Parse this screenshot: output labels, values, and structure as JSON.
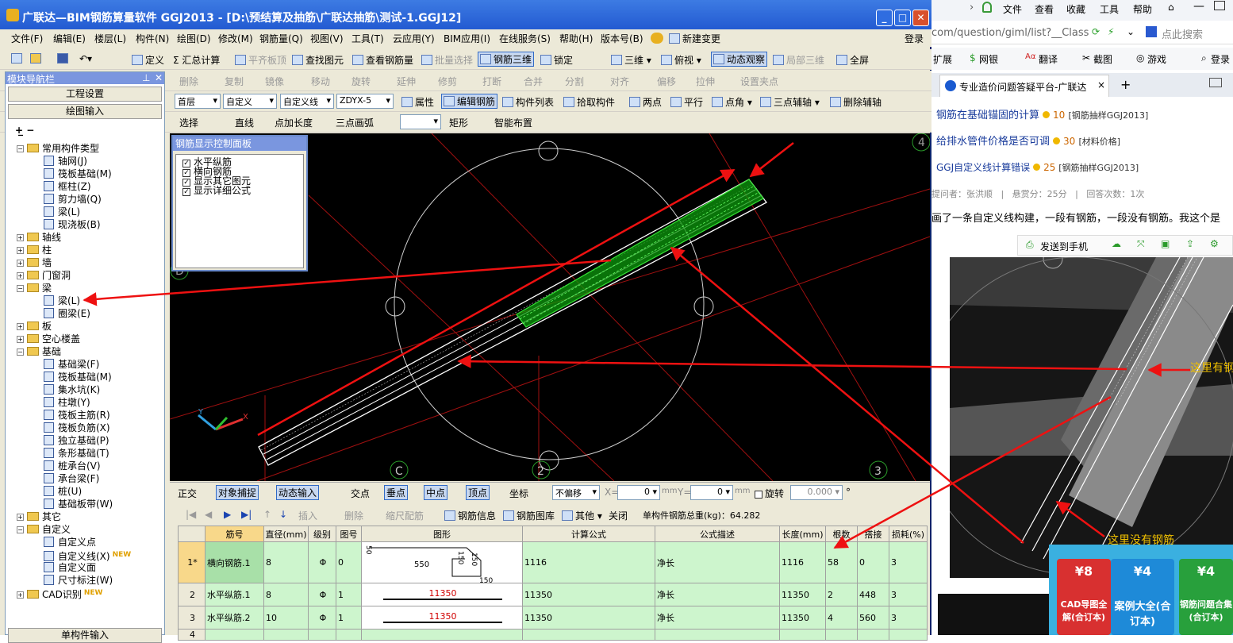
{
  "window": {
    "title": "广联达—BIM钢筋算量软件 GGJ2013 - [D:\\预结算及抽筋\\广联达抽筋\\测试-1.GGJ12]",
    "min": "_",
    "max": "□",
    "close": "✕"
  },
  "menu": [
    "文件(F)",
    "编辑(E)",
    "楼层(L)",
    "构件(N)",
    "绘图(D)",
    "修改(M)",
    "钢筋量(Q)",
    "视图(V)",
    "工具(T)",
    "云应用(Y)",
    "BIM应用(I)",
    "在线服务(S)",
    "帮助(H)",
    "版本号(B)",
    "新建变更",
    "登录"
  ],
  "toolbar1": [
    "定义",
    "Σ 汇总计算",
    "平齐板顶",
    "查找图元",
    "查看钢筋量",
    "批量选择",
    "钢筋三维",
    "锁定",
    "三维",
    "俯视",
    "动态观察",
    "局部三维",
    "全屏"
  ],
  "toolbar2": [
    "删除",
    "复制",
    "镜像",
    "移动",
    "旋转",
    "延伸",
    "修剪",
    "打断",
    "合并",
    "分割",
    "对齐",
    "偏移",
    "拉伸",
    "设置夹点"
  ],
  "toolbar3": {
    "floor": "首层",
    "type": "自定义",
    "subtype": "自定义线",
    "name": "ZDYX-5",
    "items": [
      "属性",
      "编辑钢筋",
      "构件列表",
      "拾取构件",
      "两点",
      "平行",
      "点角",
      "三点辅轴",
      "删除辅轴"
    ]
  },
  "toolbar4": [
    "选择",
    "直线",
    "点加长度",
    "三点画弧",
    "矩形",
    "智能布置"
  ],
  "leftpanel": {
    "title": "模块导航栏",
    "buttons": [
      "工程设置",
      "绘图输入"
    ],
    "tree": [
      {
        "label": "常用构件类型",
        "kind": "folder",
        "open": true,
        "level": 0
      },
      {
        "label": "轴网(J)",
        "kind": "item",
        "level": 1
      },
      {
        "label": "筏板基础(M)",
        "kind": "item",
        "level": 1
      },
      {
        "label": "框柱(Z)",
        "kind": "item",
        "level": 1
      },
      {
        "label": "剪力墙(Q)",
        "kind": "item",
        "level": 1
      },
      {
        "label": "梁(L)",
        "kind": "item",
        "level": 1
      },
      {
        "label": "现浇板(B)",
        "kind": "item",
        "level": 1
      },
      {
        "label": "轴线",
        "kind": "folder",
        "open": false,
        "level": 0
      },
      {
        "label": "柱",
        "kind": "folder",
        "open": false,
        "level": 0
      },
      {
        "label": "墙",
        "kind": "folder",
        "open": false,
        "level": 0
      },
      {
        "label": "门窗洞",
        "kind": "folder",
        "open": false,
        "level": 0
      },
      {
        "label": "梁",
        "kind": "folder",
        "open": true,
        "level": 0
      },
      {
        "label": "梁(L)",
        "kind": "item",
        "level": 1
      },
      {
        "label": "圈梁(E)",
        "kind": "item",
        "level": 1
      },
      {
        "label": "板",
        "kind": "folder",
        "open": false,
        "level": 0
      },
      {
        "label": "空心楼盖",
        "kind": "folder",
        "open": false,
        "level": 0
      },
      {
        "label": "基础",
        "kind": "folder",
        "open": true,
        "level": 0
      },
      {
        "label": "基础梁(F)",
        "kind": "item",
        "level": 1
      },
      {
        "label": "筏板基础(M)",
        "kind": "item",
        "level": 1
      },
      {
        "label": "集水坑(K)",
        "kind": "item",
        "level": 1
      },
      {
        "label": "柱墩(Y)",
        "kind": "item",
        "level": 1
      },
      {
        "label": "筏板主筋(R)",
        "kind": "item",
        "level": 1
      },
      {
        "label": "筏板负筋(X)",
        "kind": "item",
        "level": 1
      },
      {
        "label": "独立基础(P)",
        "kind": "item",
        "level": 1
      },
      {
        "label": "条形基础(T)",
        "kind": "item",
        "level": 1
      },
      {
        "label": "桩承台(V)",
        "kind": "item",
        "level": 1
      },
      {
        "label": "承台梁(F)",
        "kind": "item",
        "level": 1
      },
      {
        "label": "桩(U)",
        "kind": "item",
        "level": 1
      },
      {
        "label": "基础板带(W)",
        "kind": "item",
        "level": 1
      },
      {
        "label": "其它",
        "kind": "folder",
        "open": false,
        "level": 0
      },
      {
        "label": "自定义",
        "kind": "folder",
        "open": true,
        "level": 0
      },
      {
        "label": "自定义点",
        "kind": "item",
        "level": 1
      },
      {
        "label": "自定义线(X)",
        "kind": "item",
        "level": 1,
        "badge": "NEW"
      },
      {
        "label": "自定义面",
        "kind": "item",
        "level": 1
      },
      {
        "label": "尺寸标注(W)",
        "kind": "item",
        "level": 1
      },
      {
        "label": "CAD识别",
        "kind": "folder",
        "open": false,
        "level": 0,
        "badge": "NEW"
      }
    ],
    "footer": "单构件输入"
  },
  "ctrlpanel": {
    "title": "钢筋显示控制面板",
    "options": [
      "水平纵筋",
      "横向钢筋",
      "显示其它图元",
      "显示详细公式"
    ]
  },
  "viewport": {
    "axis_labels": [
      "4",
      "D",
      "C",
      "2",
      "3"
    ],
    "beam_color": "#22c022",
    "arrow_color": "#ee1111"
  },
  "snapbar": {
    "items": [
      "正交",
      "对象捕捉",
      "动态输入",
      "交点",
      "垂点",
      "中点",
      "顶点",
      "坐标"
    ],
    "offset": "不偏移",
    "x_label": "X=",
    "x_val": "0",
    "y_label": "Y=",
    "y_val": "0",
    "unit": "mm",
    "rotate_label": "旋转",
    "rotate_val": "0.000",
    "deg": "°"
  },
  "gridbar": {
    "items": [
      "插入",
      "删除",
      "缩尺配筋",
      "钢筋信息",
      "钢筋图库",
      "其他",
      "关闭"
    ],
    "total": "单构件钢筋总重(kg)：64.282"
  },
  "grid": {
    "headers": [
      "",
      "筋号",
      "直径(mm)",
      "级别",
      "图号",
      "图形",
      "计算公式",
      "公式描述",
      "长度(mm)",
      "根数",
      "搭接",
      "损耗(%)"
    ],
    "rows": [
      {
        "n": "1*",
        "name": "横向钢筋.1",
        "dia": "8",
        "grade": "Φ",
        "fig": "0",
        "shape": {
          "a": "550",
          "b": "150",
          "c": "50",
          "d": "150",
          "e": "65"
        },
        "formula": "1116",
        "desc": "净长",
        "len": "1116",
        "count": "58",
        "lap": "0",
        "loss": "3"
      },
      {
        "n": "2",
        "name": "水平纵筋.1",
        "dia": "8",
        "grade": "Φ",
        "fig": "1",
        "shape": {
          "a": "11350"
        },
        "formula": "11350",
        "desc": "净长",
        "len": "11350",
        "count": "2",
        "lap": "448",
        "loss": "3"
      },
      {
        "n": "3",
        "name": "水平纵筋.2",
        "dia": "10",
        "grade": "Φ",
        "fig": "1",
        "shape": {
          "a": "11350"
        },
        "formula": "11350",
        "desc": "净长",
        "len": "11350",
        "count": "4",
        "lap": "560",
        "loss": "3"
      },
      {
        "n": "4",
        "name": "",
        "dia": "",
        "grade": "",
        "fig": "",
        "shape": {
          "a": ""
        },
        "formula": "",
        "desc": "",
        "len": "",
        "count": "",
        "lap": "",
        "loss": ""
      }
    ]
  },
  "browser": {
    "topmenu": [
      "文件",
      "查看",
      "收藏",
      "工具",
      "帮助"
    ],
    "address": "com/question/giml/list?__Class",
    "search_placeholder": "点此搜索",
    "tools": [
      "扩展",
      "网银",
      "翻译",
      "截图",
      "游戏",
      "登录"
    ],
    "tab": "专业造价问题答疑平台-广联达",
    "tab_close": "×",
    "tab_new": "+",
    "links": [
      {
        "text": "钢筋在基础锚固的计算",
        "pts": "10",
        "tag": "[钢筋抽样GGJ2013]"
      },
      {
        "text": "给排水管件价格是否可调",
        "pts": "30",
        "tag": "[材料价格]"
      },
      {
        "text": "GGJ自定义线计算错误",
        "pts": "25",
        "tag": "[钢筋抽样GGJ2013]"
      }
    ],
    "meta": "提问者：张洪顺   |   悬赏分：25分   |   回答次数：1次",
    "question": "画了一条自定义线构建，一段有钢筋，一段没有钢筋。我这个是",
    "send": "发送到手机",
    "note_yes": "这里有钢",
    "note_no": "这里没有钢筋",
    "books": [
      {
        "price": "¥8",
        "title": "CAD导图全解(合订本)"
      },
      {
        "price": "¥4",
        "title": "案例大全(合订本)"
      },
      {
        "price": "¥4",
        "title": "钢筋问题合集(合订本)"
      }
    ]
  }
}
